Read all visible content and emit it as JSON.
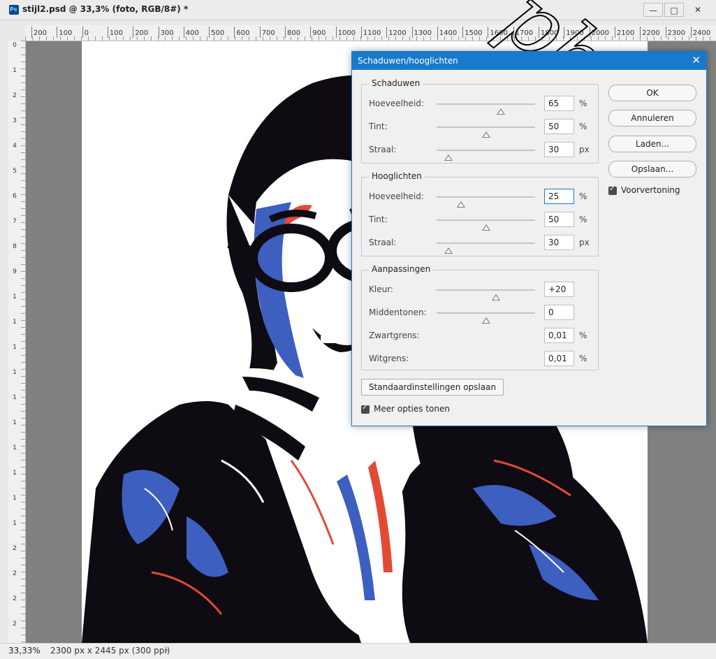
{
  "window": {
    "doc_title": "stijl2.psd @ 33,3% (foto, RGB/8#) *",
    "minimize": "—",
    "restore": "□",
    "close": "✕"
  },
  "ruler_h": [
    "200",
    "100",
    "0",
    "100",
    "200",
    "300",
    "400",
    "500",
    "600",
    "700",
    "800",
    "900",
    "1000",
    "1100",
    "1200",
    "1300",
    "1400",
    "1500",
    "1600",
    "1700",
    "1800",
    "1900",
    "2000",
    "2100",
    "2200",
    "2300",
    "2400"
  ],
  "ruler_v": [
    "0",
    "1",
    "2",
    "3",
    "4",
    "5",
    "6",
    "7",
    "8",
    "9",
    "1",
    "1",
    "1",
    "1",
    "1",
    "1",
    "1",
    "1",
    "1",
    "1",
    "2",
    "2",
    "2",
    "2"
  ],
  "status": {
    "zoom": "33,33%",
    "doc_info": "2300 px x 2445 px (300 ppi)",
    "arrow": "›"
  },
  "dialog": {
    "title": "Schaduwen/hooglichten",
    "close": "✕",
    "shadows": {
      "legend": "Schaduwen",
      "rows": [
        {
          "label": "Hoeveelheid:",
          "value": "65",
          "unit": "%",
          "level": 0.65
        },
        {
          "label": "Tint:",
          "value": "50",
          "unit": "%",
          "level": 0.5
        },
        {
          "label": "Straal:",
          "value": "30",
          "unit": "px",
          "level": 0.12
        }
      ]
    },
    "highlights": {
      "legend": "Hooglichten",
      "rows": [
        {
          "label": "Hoeveelheid:",
          "value": "25",
          "unit": "%",
          "level": 0.25
        },
        {
          "label": "Tint:",
          "value": "50",
          "unit": "%",
          "level": 0.5
        },
        {
          "label": "Straal:",
          "value": "30",
          "unit": "px",
          "level": 0.12
        }
      ]
    },
    "adjustments": {
      "legend": "Aanpassingen",
      "rows": [
        {
          "label": "Kleur:",
          "value": "+20",
          "unit": "",
          "level": 0.6
        },
        {
          "label": "Middentonen:",
          "value": "0",
          "unit": "",
          "level": 0.5
        },
        {
          "label": "Zwartgrens:",
          "value": "0,01",
          "unit": "%"
        },
        {
          "label": "Witgrens:",
          "value": "0,01",
          "unit": "%"
        }
      ]
    },
    "buttons": {
      "ok": "OK",
      "cancel": "Annuleren",
      "load": "Laden...",
      "save": "Opslaan..."
    },
    "preview_label": "Voorvertoning",
    "save_defaults": "Standaardinstellingen opslaan",
    "more_options": "Meer opties tonen"
  },
  "watermark": "photo",
  "colors": {
    "accent": "#1979ca",
    "art_blue": "#3d5fbf",
    "art_red": "#e24a33",
    "art_dark": "#0f0b12"
  }
}
